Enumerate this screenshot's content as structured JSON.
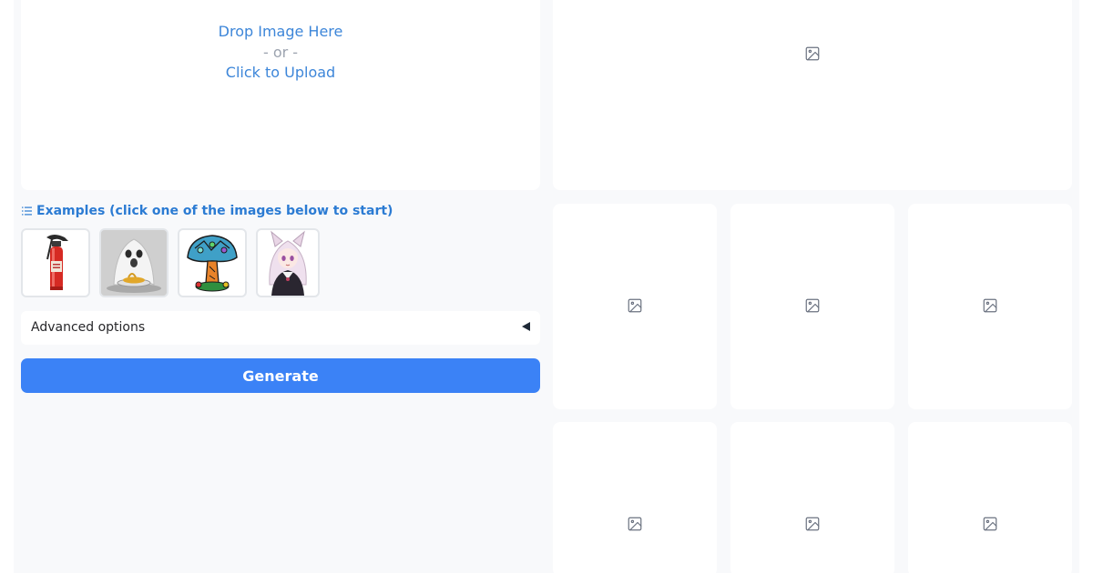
{
  "upload": {
    "drop_text": "Drop Image Here",
    "or_text": "- or -",
    "click_text": "Click to Upload"
  },
  "examples": {
    "title": "Examples (click one of the images below to start)",
    "items": [
      {
        "subject": "fire extinguisher"
      },
      {
        "subject": "ghost eating noodles"
      },
      {
        "subject": "stained glass mushroom"
      },
      {
        "subject": "anime cat girl"
      }
    ]
  },
  "advanced": {
    "label": "Advanced options"
  },
  "generate": {
    "label": "Generate"
  },
  "outputs": {
    "icon": "image-placeholder-icon"
  }
}
